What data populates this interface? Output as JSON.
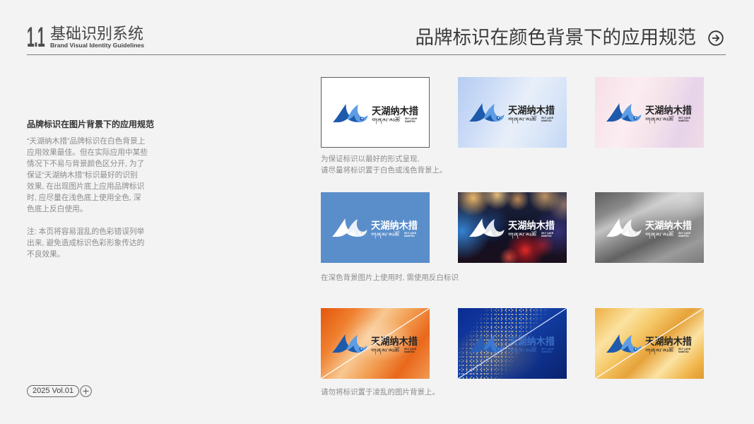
{
  "header": {
    "section_number": "1.1",
    "section_title": "基础识别系统",
    "section_subtitle": "Brand Visual Identity Guidelines",
    "page_title": "品牌标识在颜色背景下的应用规范"
  },
  "intro": {
    "heading": "品牌标识在图片背景下的应用规范",
    "paragraph": [
      "“天湖纳木措”品牌标识在白色背景上",
      "应用效果最佳。但在实际应用中某些",
      "情况下不易与背景颜色区分开, 为了",
      "保证“天湖纳木措”标识最好的识别",
      "效果, 在出现图片底上应用品牌标识",
      "时, 应尽量在浅色底上使用全色, 深",
      "色底上反白使用。"
    ],
    "note": [
      "注: 本页将容易混乱的色彩错误列举",
      "出来, 避免造成标识色彩形象传达的",
      "不良效果。"
    ]
  },
  "logo": {
    "name_cn": "天湖纳木措",
    "name_tibetan": "གནམ་མཚོ",
    "name_en_line1": "SKY LAKE",
    "name_en_line2": "NAMTSO"
  },
  "captions": {
    "light_background": [
      "为保证标识以最好的形式呈现,",
      "请尽量将标识置于白色或浅色背景上。"
    ],
    "dark_background": "在深色背景图片上使用时, 需使用反白标识",
    "busy_background": "请勿将标识置于凌乱的图片背景上。"
  },
  "footer": {
    "volume": "2025 Vol.01"
  },
  "icons": {
    "next_page": "circle-arrow-right-icon",
    "add": "circle-plus-icon"
  },
  "colors": {
    "brand_blue": "#1d5aab",
    "brand_light_blue": "#5e9de4",
    "page_background": "#f3f3f3",
    "solid_blue_background": "#5a8ecb",
    "reversed_logo": "#ffffff",
    "text_dark": "#333333",
    "text_muted": "#8c8c8c"
  }
}
